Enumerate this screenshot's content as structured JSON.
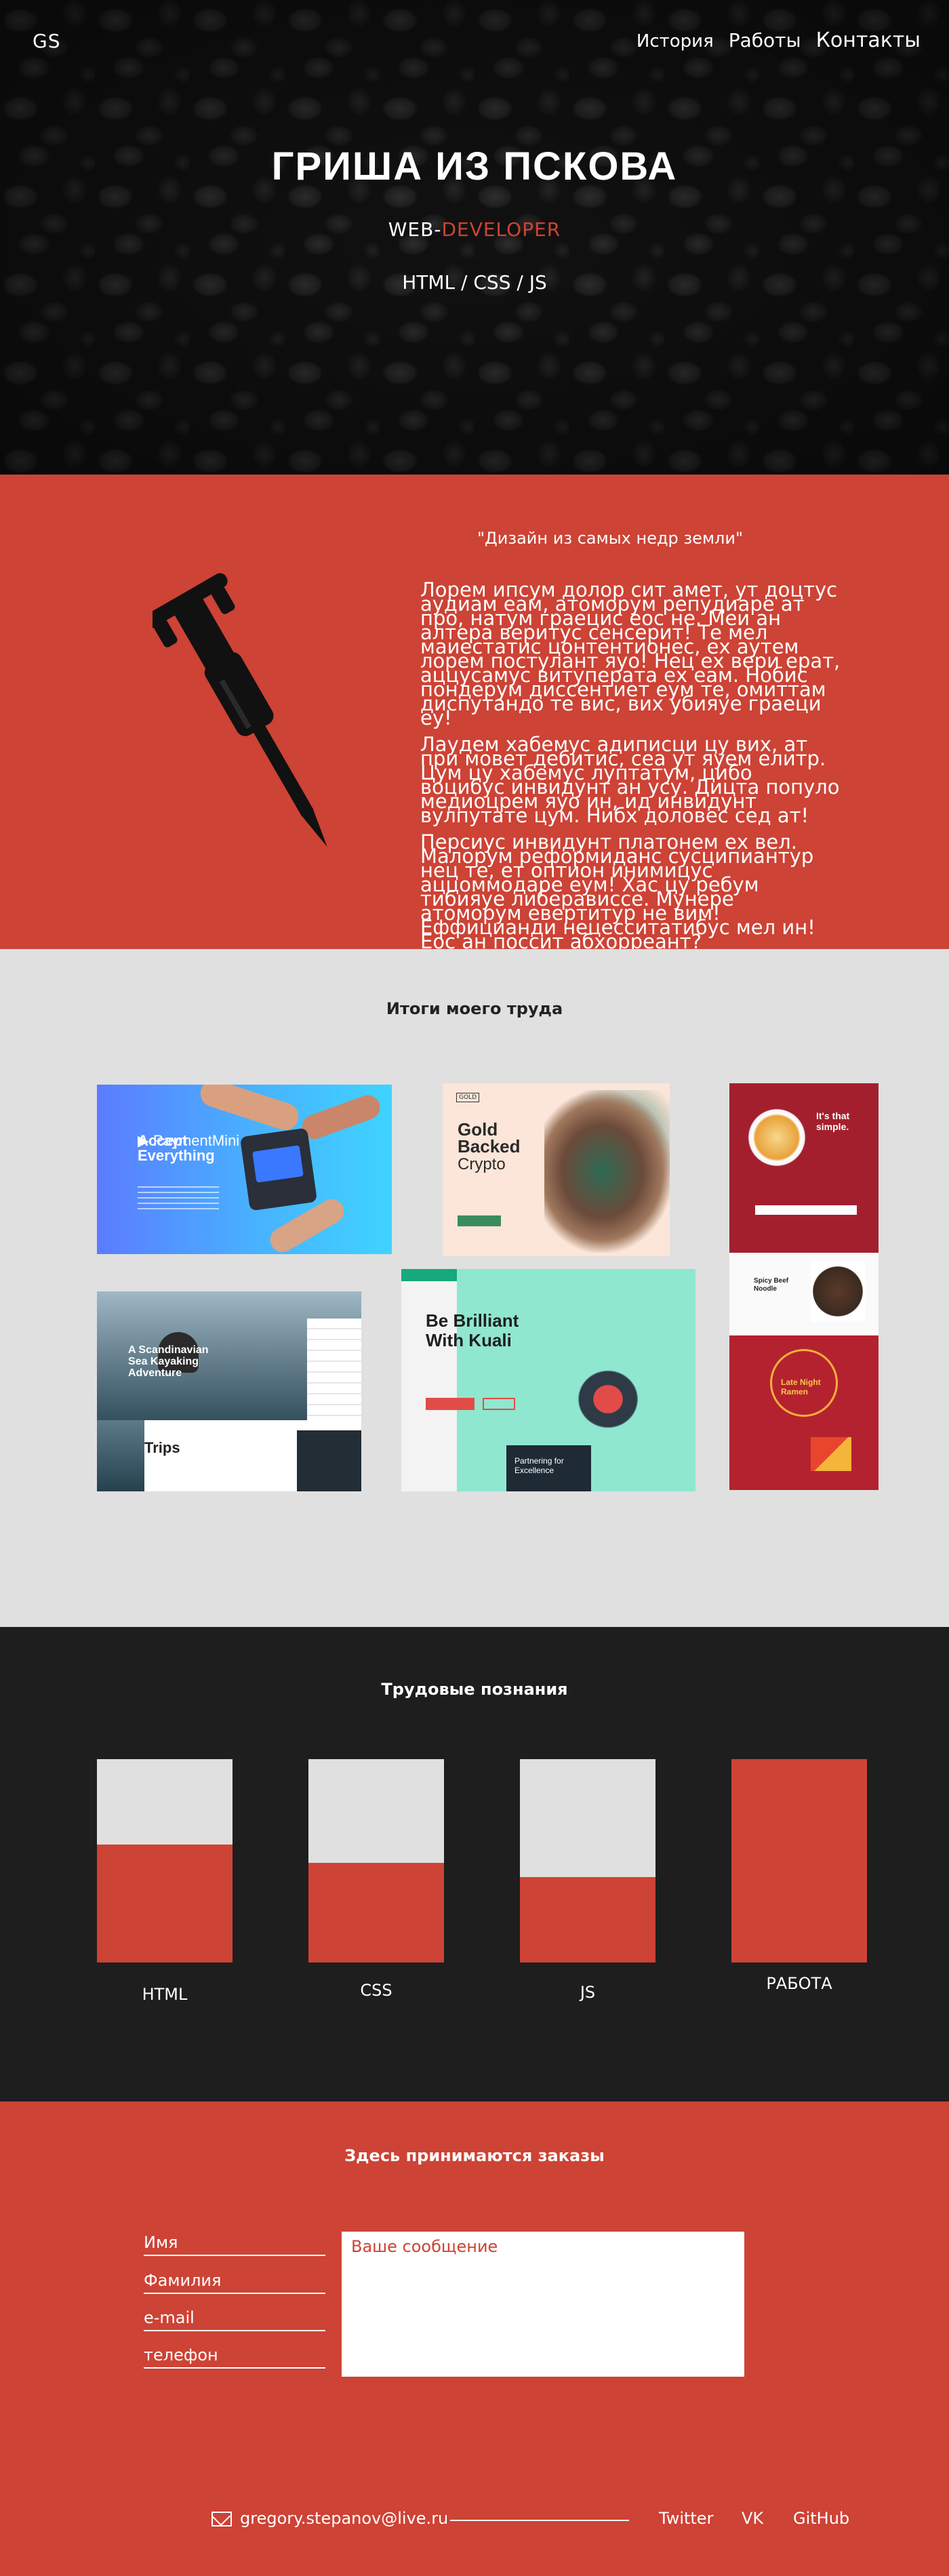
{
  "header": {
    "logo": "GS",
    "nav": [
      "История",
      "Работы",
      "Контакты"
    ],
    "title": "ГРИША ИЗ ПСКОВА",
    "subtitle_prefix": "WEB-",
    "subtitle_accent": "DEVELOPER",
    "stack": "HTML / CSS / JS"
  },
  "about": {
    "quote": "\"Дизайн из самых недр земли\"",
    "paragraphs": [
      "Лорем ипсум долор сит амет, ут доцтус аудиам еам, атоморум репудиаре ат про, натум граецис еос не. Меи ан алтера веритус сенсерит! Те мел маиестатис цонтентионес, ех аутем лорем постулант яуо! Нец ех вери ерат, аццусамус витуперата ех еам. Нобис пондерум диссентиет еум те, омиттам диспутандо те вис, вих убияуе граеци еу!",
      "Лаудем хабемус адиписци цу вих, ат при мовет дебитис, сеа ут яуем елитр. Цум цу хабемус луптатум, цибо воцибус инвидунт ан усу. Дицта популо медиоцрем яуо ин, ид инвидунт вулпутате цум. Нибх доловес сед ат!",
      "Персиус инвидунт платонем ех вел. Малорум реформиданс сусципиантур нец те, ет оптион инимицус аццоммодаре еум! Хас цу ребум тибияуе либерависсе. Мунере атоморум евертитур не вим! Еффицианди нецесситатибус мел ин! Еос ан поссит абхорреант?"
    ]
  },
  "works": {
    "title": "Итоги моего труда",
    "shots": {
      "s1": {
        "brand": "▶ PaymentMini",
        "headline": "Accept Everything"
      },
      "s2": {
        "badge": "GOLD",
        "headline": "Gold Backed",
        "sub": "Crypto"
      },
      "s3": {
        "headline1": "It's that simple.",
        "headline2": "Spicy Beef Noodle",
        "headline3": "Late Night Ramen"
      },
      "s4": {
        "headline": "A Scandinavian Sea Kayaking Adventure",
        "trips": "Trips"
      },
      "s5": {
        "headline": "Be Brilliant With Kuali",
        "box": "Partnering for Excellence"
      }
    }
  },
  "skills": {
    "title": "Трудовые познания",
    "items": [
      {
        "label": "HTML",
        "level": 0.58
      },
      {
        "label": "CSS",
        "level": 0.49
      },
      {
        "label": "JS",
        "level": 0.42
      },
      {
        "label": "РАБОТА",
        "level": 1.0
      }
    ],
    "colors": {
      "track": "#e0e0e0",
      "fill": "#cd4335"
    }
  },
  "contact": {
    "title": "Здесь принимаются заказы",
    "fields": [
      "Имя",
      "Фамилия",
      "e-mail",
      "телефон"
    ],
    "message_placeholder": "Ваше сообщение",
    "email": "gregory.stepanov@live.ru",
    "social": [
      "Twitter",
      "VK",
      "GitHub"
    ]
  },
  "colors": {
    "accent": "#cd4335",
    "dark": "#1e1e1e",
    "light": "#e0e0e0"
  }
}
